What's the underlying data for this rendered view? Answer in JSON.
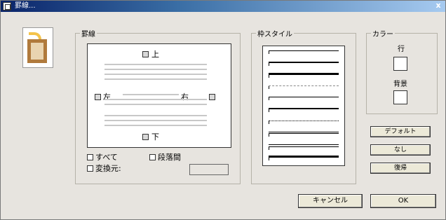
{
  "window": {
    "title": "罫線...",
    "close": "x"
  },
  "keisen": {
    "group_title": "罫線",
    "top": "上",
    "left": "左",
    "right": "右",
    "bottom": "下",
    "all": "すべて",
    "paragraph": "段落間",
    "replace": "変換元:"
  },
  "style": {
    "group_title": "枠スタイル"
  },
  "color": {
    "group_title": "カラー",
    "row": "行",
    "background": "背景"
  },
  "buttons": {
    "default": "デフォルト",
    "none": "なし",
    "restore": "復帰",
    "cancel": "キャンセル",
    "ok": "OK"
  }
}
